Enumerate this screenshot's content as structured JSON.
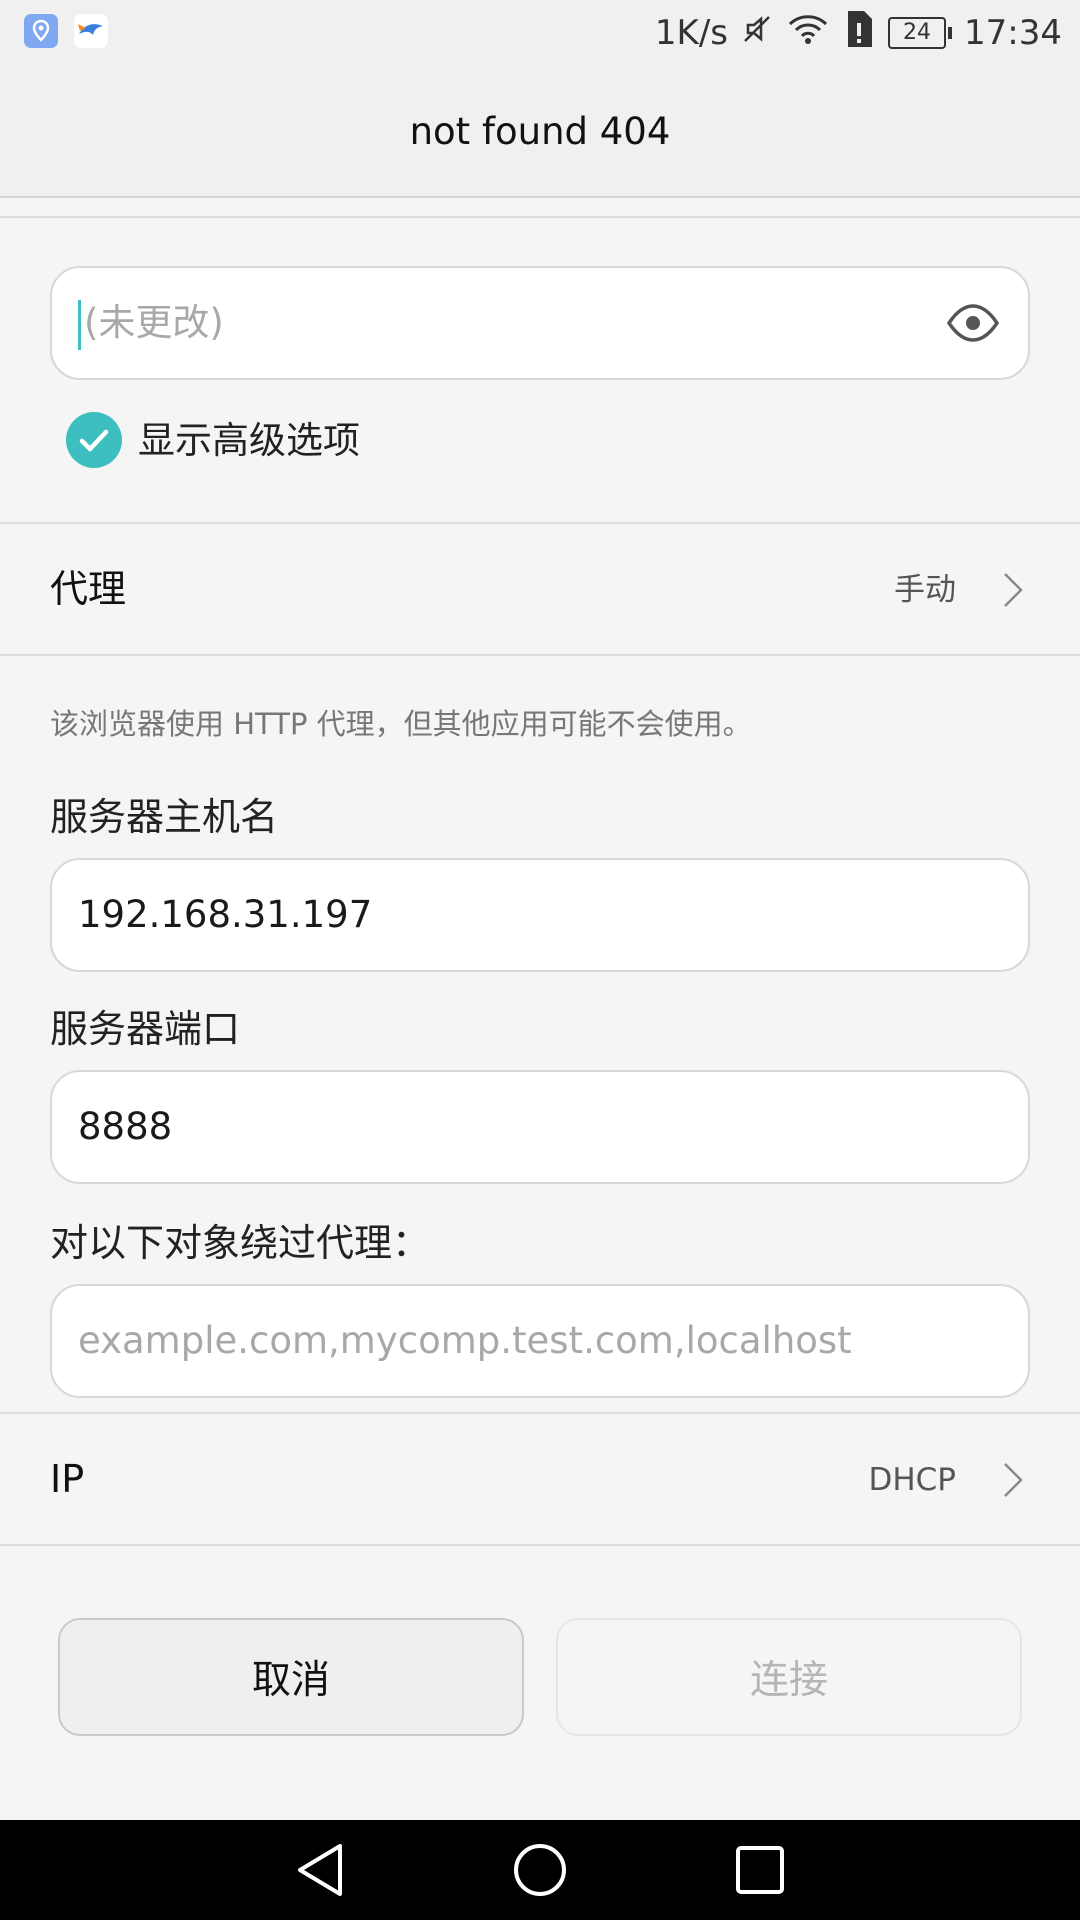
{
  "status_bar": {
    "net_speed": "1K/s",
    "battery": "24",
    "time": "17:34",
    "icons": [
      "location-app-icon",
      "bird-app-icon",
      "mute-icon",
      "wifi-icon",
      "sim-alert-icon",
      "battery-icon"
    ]
  },
  "header": {
    "title": "not found 404"
  },
  "password": {
    "placeholder": "(未更改)"
  },
  "advanced": {
    "label": "显示高级选项",
    "checked": true
  },
  "proxy": {
    "label": "代理",
    "value": "手动"
  },
  "proxy_note": "该浏览器使用 HTTP 代理，但其他应用可能不会使用。",
  "host": {
    "label": "服务器主机名",
    "value": "192.168.31.197"
  },
  "port": {
    "label": "服务器端口",
    "value": "8888"
  },
  "bypass": {
    "label": "对以下对象绕过代理：",
    "placeholder": "example.com,mycomp.test.com,localhost"
  },
  "ip": {
    "label": "IP",
    "value": "DHCP"
  },
  "buttons": {
    "cancel": "取消",
    "connect": "连接"
  },
  "colors": {
    "accent": "#3dbfbf",
    "background": "#f5f5f5",
    "navbar": "#000000"
  }
}
